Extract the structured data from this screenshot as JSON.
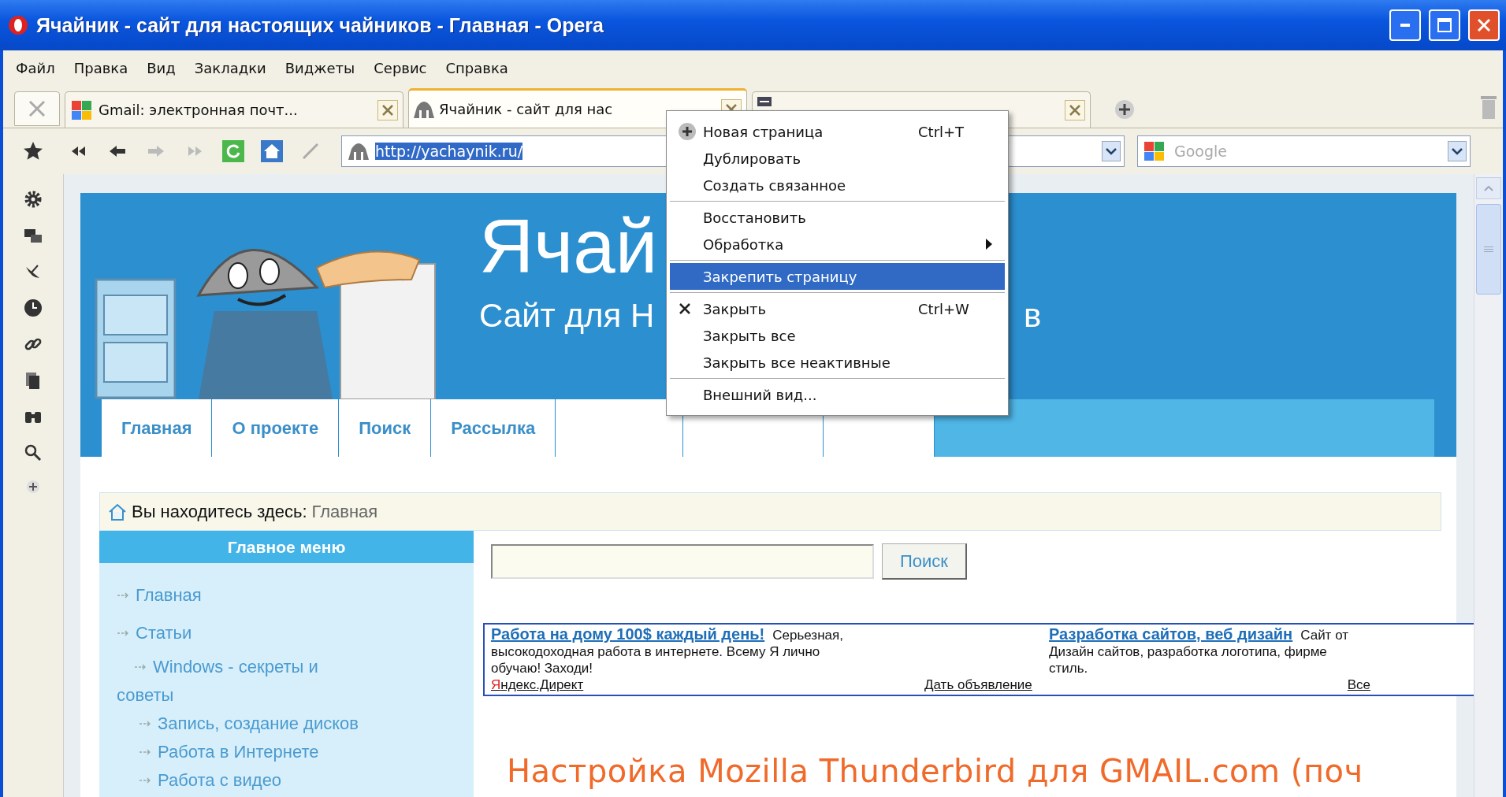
{
  "window": {
    "title": "Ячайник - сайт для настоящих чайников - Главная - Opera"
  },
  "menu_bar": [
    "Файл",
    "Правка",
    "Вид",
    "Закладки",
    "Виджеты",
    "Сервис",
    "Справка"
  ],
  "tabs": [
    {
      "kind": "gmail",
      "label": "Gmail: электронная почт...",
      "selected": false
    },
    {
      "kind": "site",
      "label": "Ячайник - сайт для нас",
      "selected": true
    },
    {
      "kind": "page",
      "selected": false
    }
  ],
  "address_bar": {
    "value": "http://yachaynik.ru/",
    "text_selected": true
  },
  "search_field": {
    "placeholder": "Google"
  },
  "context_menu": {
    "groups": [
      {
        "items": [
          {
            "label": "Новая страница",
            "shortcut": "Ctrl+T",
            "kind": "plus",
            "selected": false
          },
          {
            "label": "Дублировать",
            "selected": false
          },
          {
            "label": "Создать связанное",
            "selected": false
          }
        ]
      },
      {
        "items": [
          {
            "label": "Восстановить",
            "selected": false
          },
          {
            "label": "Обработка",
            "submenu": true,
            "selected": false
          }
        ]
      },
      {
        "items": [
          {
            "label": "Закрепить страницу",
            "selected": true
          }
        ]
      },
      {
        "items": [
          {
            "label": "Закрыть",
            "shortcut": "Ctrl+W",
            "kind": "cross",
            "selected": false
          },
          {
            "label": "Закрыть все",
            "selected": false
          },
          {
            "label": "Закрыть все неактивные",
            "selected": false
          }
        ]
      },
      {
        "items": [
          {
            "label": "Внешний вид...",
            "selected": false
          }
        ]
      }
    ]
  },
  "page": {
    "banner": {
      "title": "Ячай",
      "subtitle": "Сайт для Н",
      "subtitle_tail": "в",
      "nav": [
        {
          "label": "Главная"
        },
        {
          "label": "О проекте"
        },
        {
          "label": "Поиск"
        },
        {
          "label": "Рассылка"
        }
      ]
    },
    "breadcrumb": {
      "label": "Вы находитесь здесь:",
      "current": "Главная"
    },
    "main_menu": {
      "title": "Главное меню",
      "items": [
        {
          "label": "Главная"
        },
        {
          "label": "Статьи",
          "children": [
            {
              "label": "Windows - секреты и советы"
            },
            {
              "label": "Запись, создание дисков"
            },
            {
              "label": "Работа в Интернете"
            },
            {
              "label": "Работа с видео"
            }
          ]
        }
      ]
    },
    "search": {
      "button": "Поиск"
    },
    "ads": [
      {
        "title": "Работа на дому 100$ каждый день!",
        "lead": "Серьезная,",
        "lines": [
          "высокодоходная работа в интернете. Всему Я лично",
          "обучаю! Заходи!"
        ]
      },
      {
        "title": "Разработка сайтов, веб дизайн",
        "lead": "Сайт от",
        "lines": [
          "Дизайн сайтов, разработка логотипа, фирме",
          "стиль."
        ]
      }
    ],
    "ad_footer": {
      "source": "Яндекс.Директ",
      "post": "Дать объявление",
      "all": "Все"
    },
    "article_title": "Настройка Mozilla Thunderbird для GMAIL.com (поч"
  }
}
